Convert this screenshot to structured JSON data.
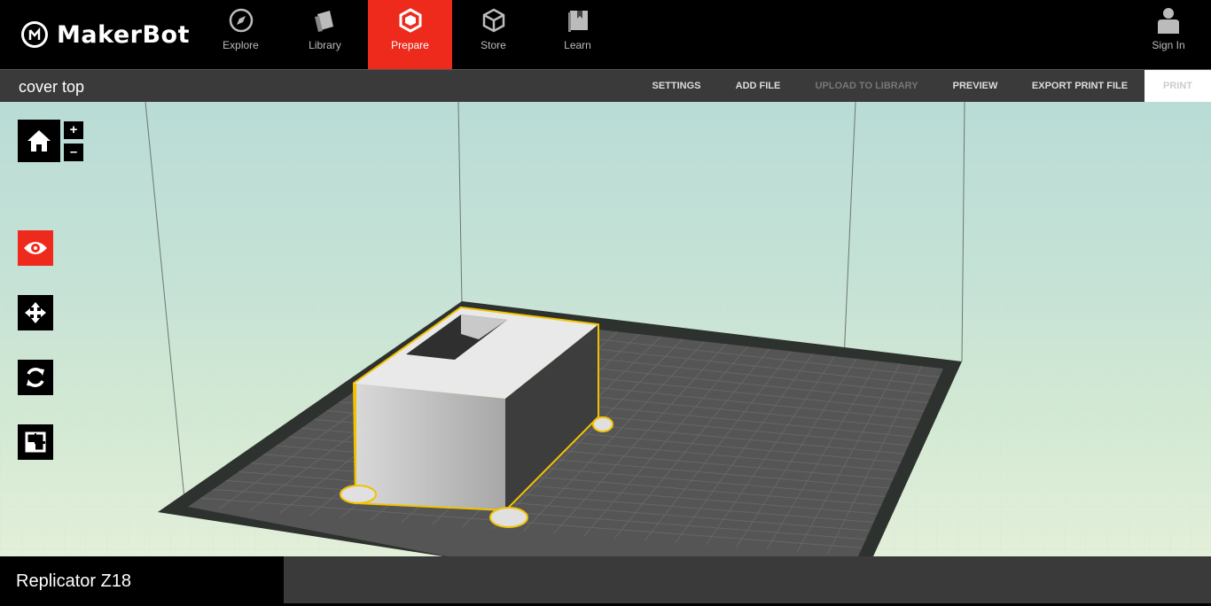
{
  "app": {
    "brand": "MakerBot"
  },
  "nav": {
    "items": [
      {
        "label": "Explore",
        "icon": "compass-icon"
      },
      {
        "label": "Library",
        "icon": "library-stack-icon"
      },
      {
        "label": "Prepare",
        "icon": "prepare-cube-icon",
        "active": true
      },
      {
        "label": "Store",
        "icon": "store-cube-icon"
      },
      {
        "label": "Learn",
        "icon": "book-icon"
      }
    ],
    "signin": "Sign In"
  },
  "subbar": {
    "title": "cover top",
    "actions": {
      "settings": "SETTINGS",
      "add_file": "ADD FILE",
      "upload": "UPLOAD TO LIBRARY",
      "preview": "PREVIEW",
      "export": "EXPORT PRINT FILE",
      "print": "PRINT"
    }
  },
  "tools": {
    "home": "home-icon",
    "zoom_in": "+",
    "zoom_out": "–",
    "view": "eye-icon",
    "move": "move-arrows-icon",
    "rotate": "rotate-icon",
    "scale": "scale-icon"
  },
  "colors": {
    "accent": "#ee2a1d",
    "selection": "#f2c200",
    "plate": "#555555"
  },
  "status": {
    "printer": "Replicator Z18"
  }
}
